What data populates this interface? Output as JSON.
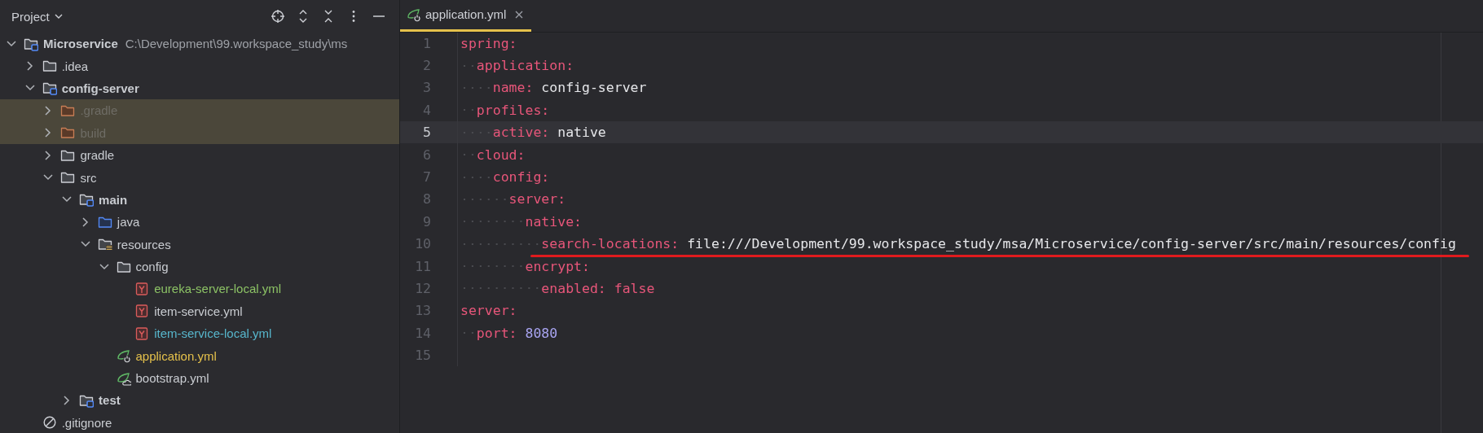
{
  "project_panel": {
    "title": "Project",
    "tree": [
      {
        "label": "Microservice",
        "path": "C:\\Development\\99.workspace_study\\ms",
        "kind": "module",
        "expanded": true,
        "excluded": false,
        "children": [
          {
            "label": ".idea",
            "kind": "folder",
            "expanded": false,
            "excluded": false
          },
          {
            "label": "config-server",
            "kind": "module",
            "expanded": true,
            "excluded": false,
            "children": [
              {
                "label": ".gradle",
                "kind": "excluded-folder",
                "expanded": false,
                "excluded": true
              },
              {
                "label": "build",
                "kind": "excluded-folder",
                "expanded": false,
                "excluded": true
              },
              {
                "label": "gradle",
                "kind": "folder",
                "expanded": false,
                "excluded": false
              },
              {
                "label": "src",
                "kind": "folder",
                "expanded": true,
                "excluded": false,
                "children": [
                  {
                    "label": "main",
                    "kind": "module",
                    "expanded": true,
                    "excluded": false,
                    "children": [
                      {
                        "label": "java",
                        "kind": "source-folder",
                        "expanded": false,
                        "excluded": false
                      },
                      {
                        "label": "resources",
                        "kind": "resources-folder",
                        "expanded": true,
                        "excluded": false,
                        "children": [
                          {
                            "label": "config",
                            "kind": "folder",
                            "expanded": true,
                            "excluded": false,
                            "children": [
                              {
                                "label": "eureka-server-local.yml",
                                "kind": "yaml",
                                "color": "#8cc265",
                                "excluded": false
                              },
                              {
                                "label": "item-service.yml",
                                "kind": "yaml",
                                "excluded": false
                              },
                              {
                                "label": "item-service-local.yml",
                                "kind": "yaml",
                                "color": "#57b6cc",
                                "excluded": false
                              }
                            ]
                          },
                          {
                            "label": "application.yml",
                            "kind": "spring-config",
                            "color": "#e5c14b",
                            "excluded": false
                          },
                          {
                            "label": "bootstrap.yml",
                            "kind": "spring-bootstrap",
                            "excluded": false
                          }
                        ]
                      }
                    ]
                  },
                  {
                    "label": "test",
                    "kind": "module",
                    "expanded": false,
                    "excluded": false
                  }
                ]
              }
            ]
          },
          {
            "label": ".gitignore",
            "kind": "ignore",
            "excluded": false
          }
        ]
      }
    ]
  },
  "editor": {
    "tabs": [
      {
        "label": "application.yml",
        "kind": "spring-config",
        "selected": true
      }
    ],
    "lines": [
      {
        "number": "1",
        "key": "spring:",
        "current": false,
        "annotated": false,
        "children": [
          {
            "number": "2",
            "key": "application:",
            "current": false,
            "annotated": false,
            "children": [
              {
                "number": "3",
                "kind": "string",
                "key": "name:",
                "value": "config-server",
                "current": false,
                "annotated": false
              }
            ]
          },
          {
            "number": "4",
            "key": "profiles:",
            "current": false,
            "annotated": false,
            "children": [
              {
                "number": "5",
                "kind": "string",
                "key": "active:",
                "value": "native",
                "current": true,
                "annotated": false
              }
            ]
          },
          {
            "number": "6",
            "key": "cloud:",
            "current": false,
            "annotated": false,
            "children": [
              {
                "number": "7",
                "key": "config:",
                "current": false,
                "annotated": false,
                "children": [
                  {
                    "number": "8",
                    "key": "server:",
                    "current": false,
                    "annotated": false,
                    "children": [
                      {
                        "number": "9",
                        "key": "native:",
                        "current": false,
                        "annotated": false,
                        "children": [
                          {
                            "number": "10",
                            "kind": "string",
                            "key": "search-locations:",
                            "value": "file:///Development/99.workspace_study/msa/Microservice/config-server/src/main/resources/config",
                            "current": false,
                            "annotated": true
                          }
                        ]
                      },
                      {
                        "number": "11",
                        "key": "encrypt:",
                        "current": false,
                        "annotated": false,
                        "children": [
                          {
                            "number": "12",
                            "kind": "boolean",
                            "key": "enabled:",
                            "value": "false",
                            "current": false,
                            "annotated": false
                          }
                        ]
                      }
                    ]
                  }
                ]
              }
            ]
          }
        ]
      },
      {
        "number": "13",
        "key": "server:",
        "current": false,
        "annotated": false,
        "children": [
          {
            "number": "14",
            "kind": "number",
            "key": "port:",
            "value": "8080",
            "current": false,
            "annotated": false
          }
        ]
      },
      {
        "number": "15",
        "current": false,
        "annotated": false
      }
    ]
  }
}
